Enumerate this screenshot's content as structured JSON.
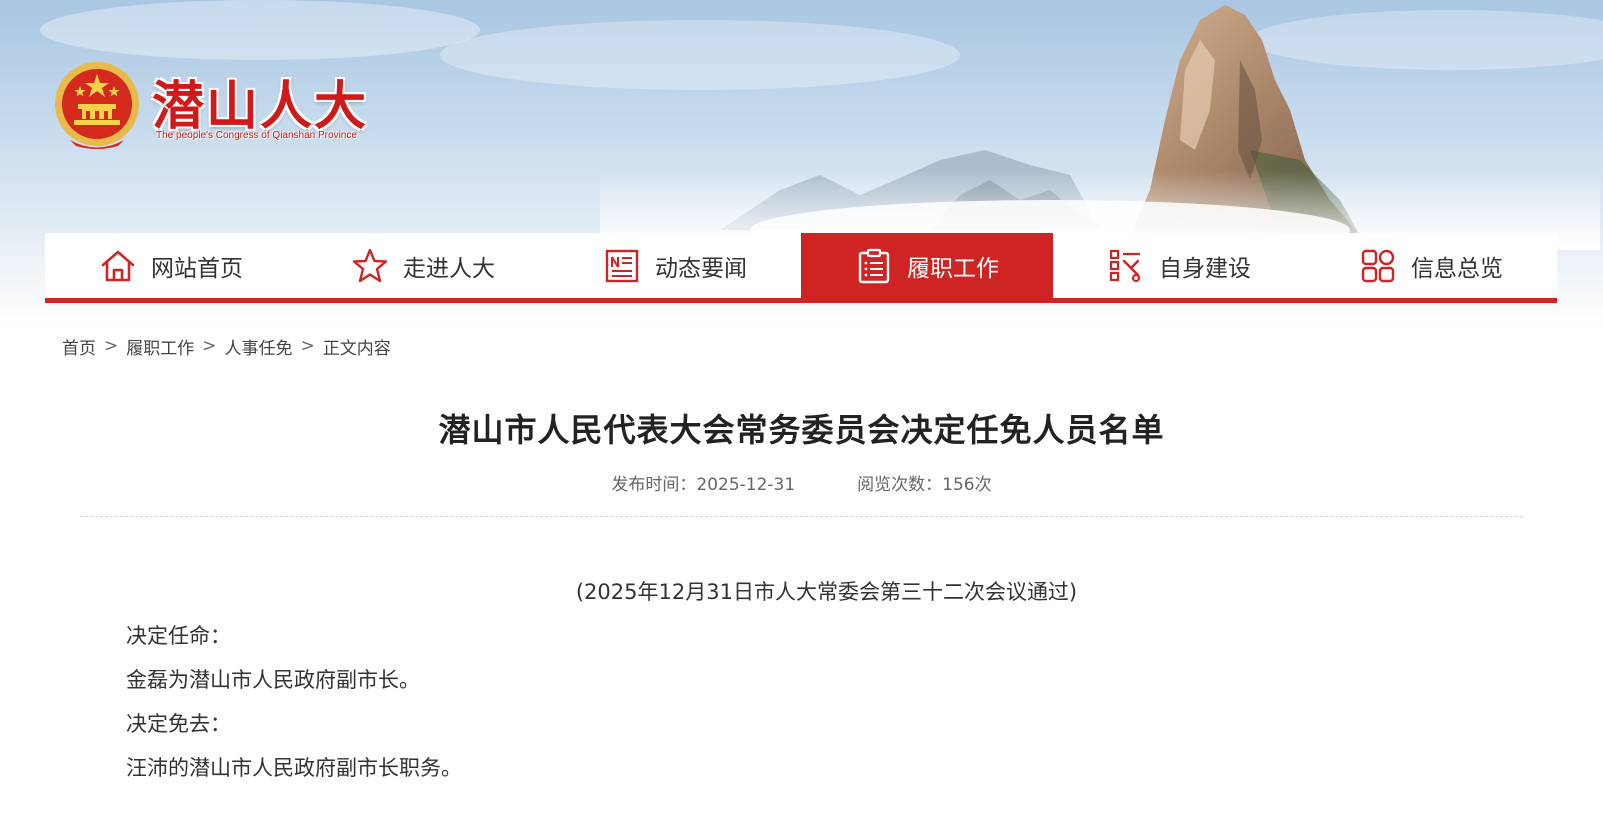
{
  "header": {
    "site_title": "潜山人大",
    "site_subtitle": "The people's Congress of Qianshan Province",
    "emblem_icon": "national-emblem-icon",
    "brand_color": "#cf2424"
  },
  "nav": {
    "items": [
      {
        "label": "网站首页",
        "icon": "home-icon",
        "active": false
      },
      {
        "label": "走进人大",
        "icon": "star-icon",
        "active": false
      },
      {
        "label": "动态要闻",
        "icon": "news-icon",
        "active": false
      },
      {
        "label": "履职工作",
        "icon": "clipboard-icon",
        "active": true
      },
      {
        "label": "自身建设",
        "icon": "build-icon",
        "active": false
      },
      {
        "label": "信息总览",
        "icon": "grid-icon",
        "active": false
      }
    ]
  },
  "breadcrumb": {
    "items": [
      "首页",
      "履职工作",
      "人事任免",
      "正文内容"
    ],
    "separator": ">"
  },
  "article": {
    "title": "潜山市人民代表大会常务委员会决定任免人员名单",
    "publish_label": "发布时间：2025-12-31",
    "views_label": "阅览次数：156次",
    "paragraphs": [
      "(2025年12月31日市人大常委会第三十二次会议通过)",
      "决定任命：",
      "金磊为潜山市人民政府副市长。",
      "决定免去：",
      "汪沛的潜山市人民政府副市长职务。"
    ]
  }
}
